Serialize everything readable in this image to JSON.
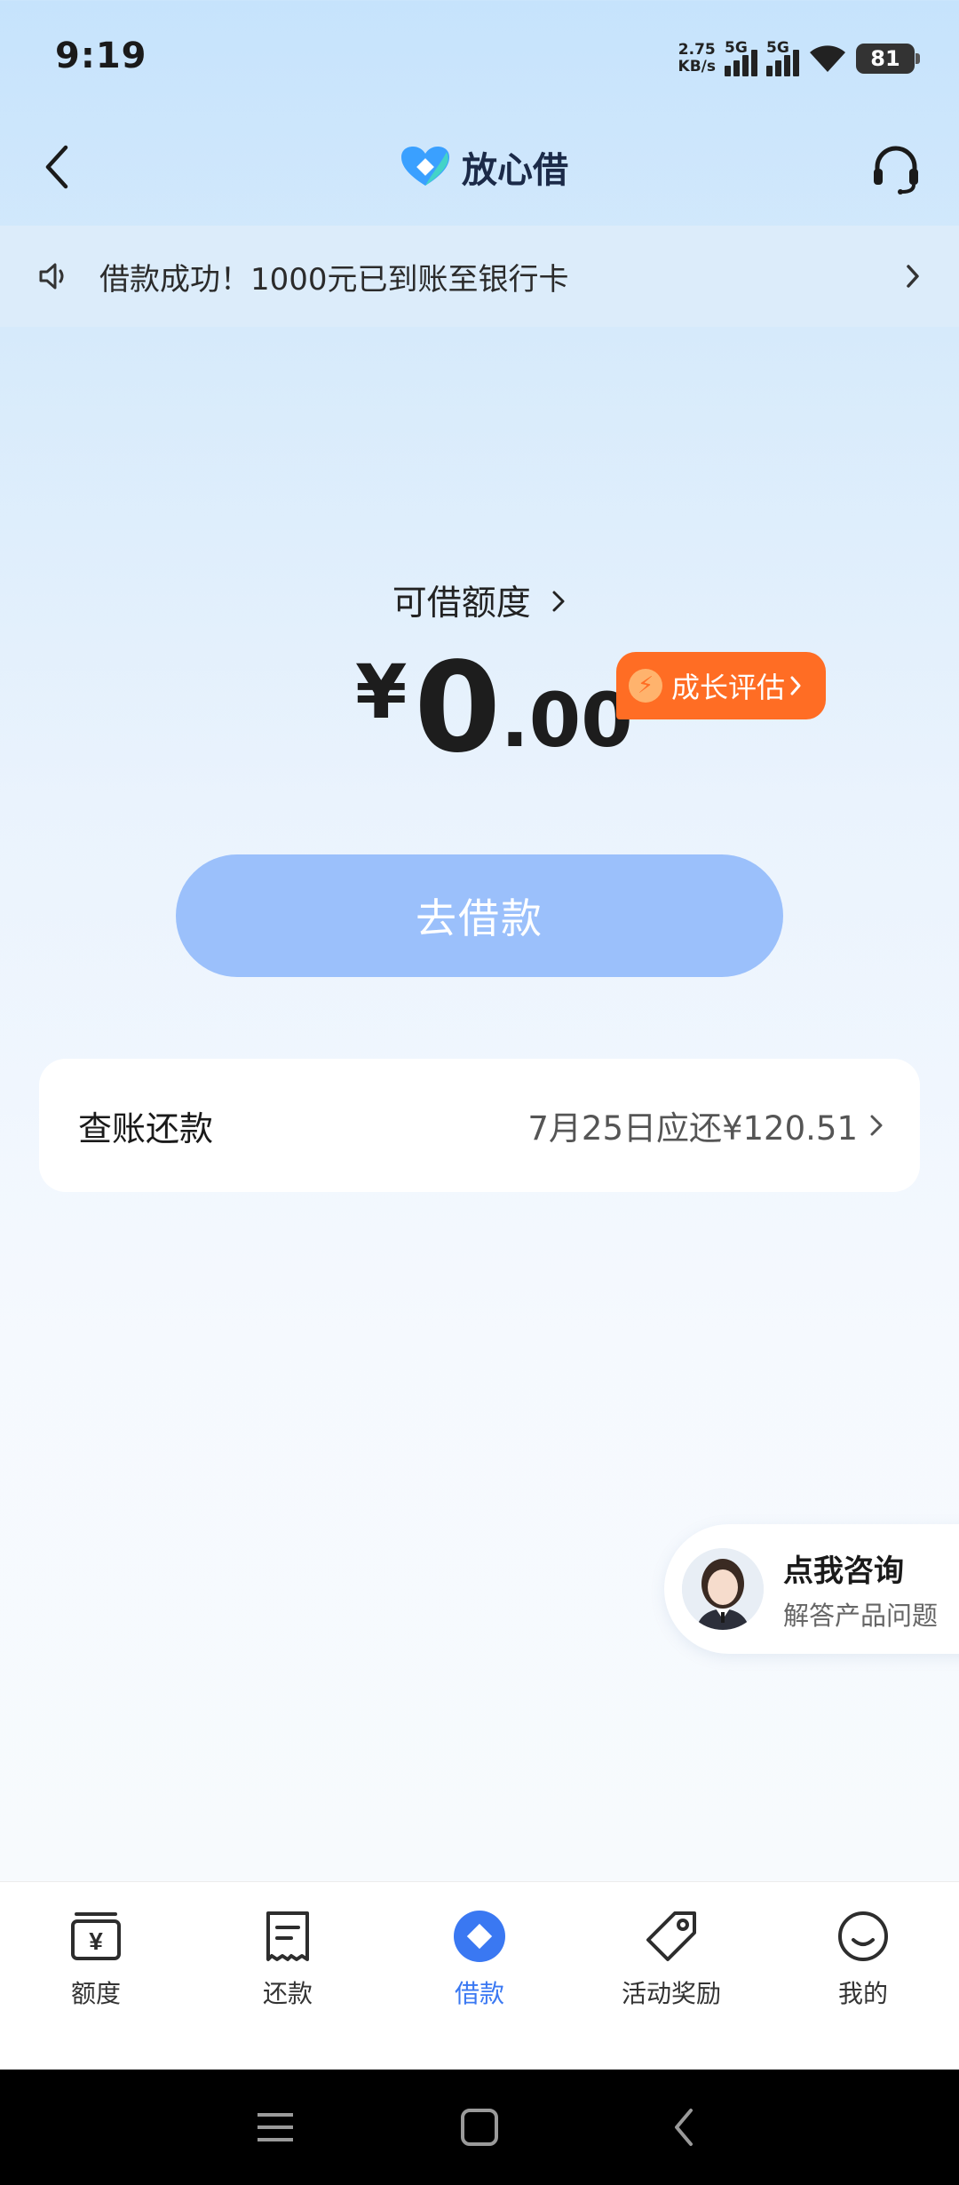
{
  "status_bar": {
    "time": "9:19",
    "net_speed_value": "2.75",
    "net_speed_unit": "KB/s",
    "sim1_label": "5G",
    "sim2_label": "5G",
    "battery": "81"
  },
  "header": {
    "brand_name": "放心借",
    "back_icon": "chevron-left-icon",
    "service_icon": "headset-icon"
  },
  "notice": {
    "text": "借款成功！1000元已到账至银行卡",
    "icon": "speaker-icon"
  },
  "credit": {
    "label": "可借额度",
    "currency": "¥",
    "integer": "0",
    "decimal": ".00",
    "growth_badge": "成长评估"
  },
  "borrow_button": "去借款",
  "repay": {
    "title": "查账还款",
    "due_text": "7月25日应还¥120.51"
  },
  "consult": {
    "title": "点我咨询",
    "subtitle": "解答产品问题"
  },
  "bottom_nav": {
    "items": [
      {
        "label": "额度",
        "icon": "quota-icon"
      },
      {
        "label": "还款",
        "icon": "repay-icon"
      },
      {
        "label": "借款",
        "icon": "borrow-icon",
        "active": true
      },
      {
        "label": "活动奖励",
        "icon": "tag-icon"
      },
      {
        "label": "我的",
        "icon": "smile-icon"
      }
    ]
  },
  "colors": {
    "accent": "#3a78f2",
    "button_disabled": "#9bc0fb",
    "badge": "#ff6d24"
  }
}
